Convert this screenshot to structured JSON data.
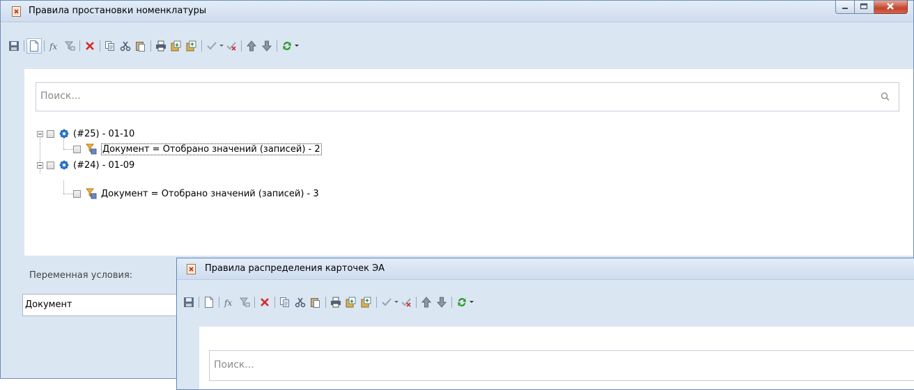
{
  "window1": {
    "title": "Правила простановки номенклатуры",
    "search_placeholder": "Поиск...",
    "tree": [
      {
        "label": "(#25) - 01-10",
        "child": "Документ = Отобрано значений (записей) - 2"
      },
      {
        "label": "(#24) - 01-09",
        "child": "Документ = Отобрано значений (записей) - 3"
      }
    ],
    "variable_label": "Переменная условия:",
    "variable_value": "Документ"
  },
  "window2": {
    "title": "Правила распределения карточек ЭА",
    "search_placeholder": "Поиск..."
  },
  "toolbar_icons": [
    "save-icon",
    "new-icon",
    "formula-icon",
    "filter-icon",
    "delete-icon",
    "copy-icon",
    "cut-icon",
    "paste-icon",
    "print-icon",
    "import-icon",
    "export-icon",
    "check-icon",
    "uncheck-icon",
    "move-up-icon",
    "move-down-icon",
    "refresh-icon"
  ],
  "colors": {
    "window_bg": "#dbe6f3",
    "titlebar": "#d6e3f2",
    "delete_red": "#d42a2a",
    "refresh_green": "#2e9b2e",
    "gear_blue": "#2f7ed8"
  }
}
